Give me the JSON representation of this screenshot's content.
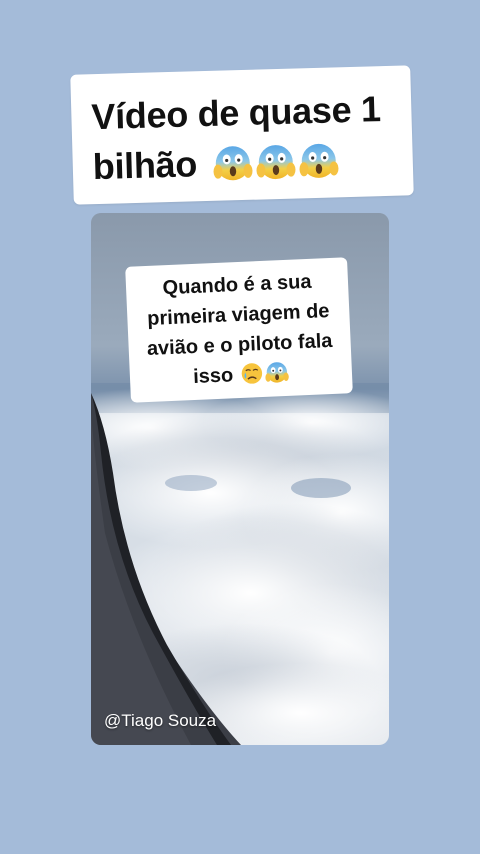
{
  "title": {
    "line1": "Vídeo de quase 1",
    "line2": "bilhão",
    "emojis": [
      "face-screaming-in-fear-icon",
      "face-screaming-in-fear-icon",
      "face-screaming-in-fear-icon"
    ]
  },
  "caption": {
    "line1": "Quando é a sua",
    "line2": "primeira viagem de",
    "line3": "avião e o piloto fala",
    "line4": "isso",
    "emojis": [
      "crying-face-icon",
      "face-screaming-in-fear-icon"
    ]
  },
  "credit": "@Tiago Souza",
  "colors": {
    "background": "#a4bbd9",
    "card": "#ffffff",
    "text": "#111111"
  }
}
